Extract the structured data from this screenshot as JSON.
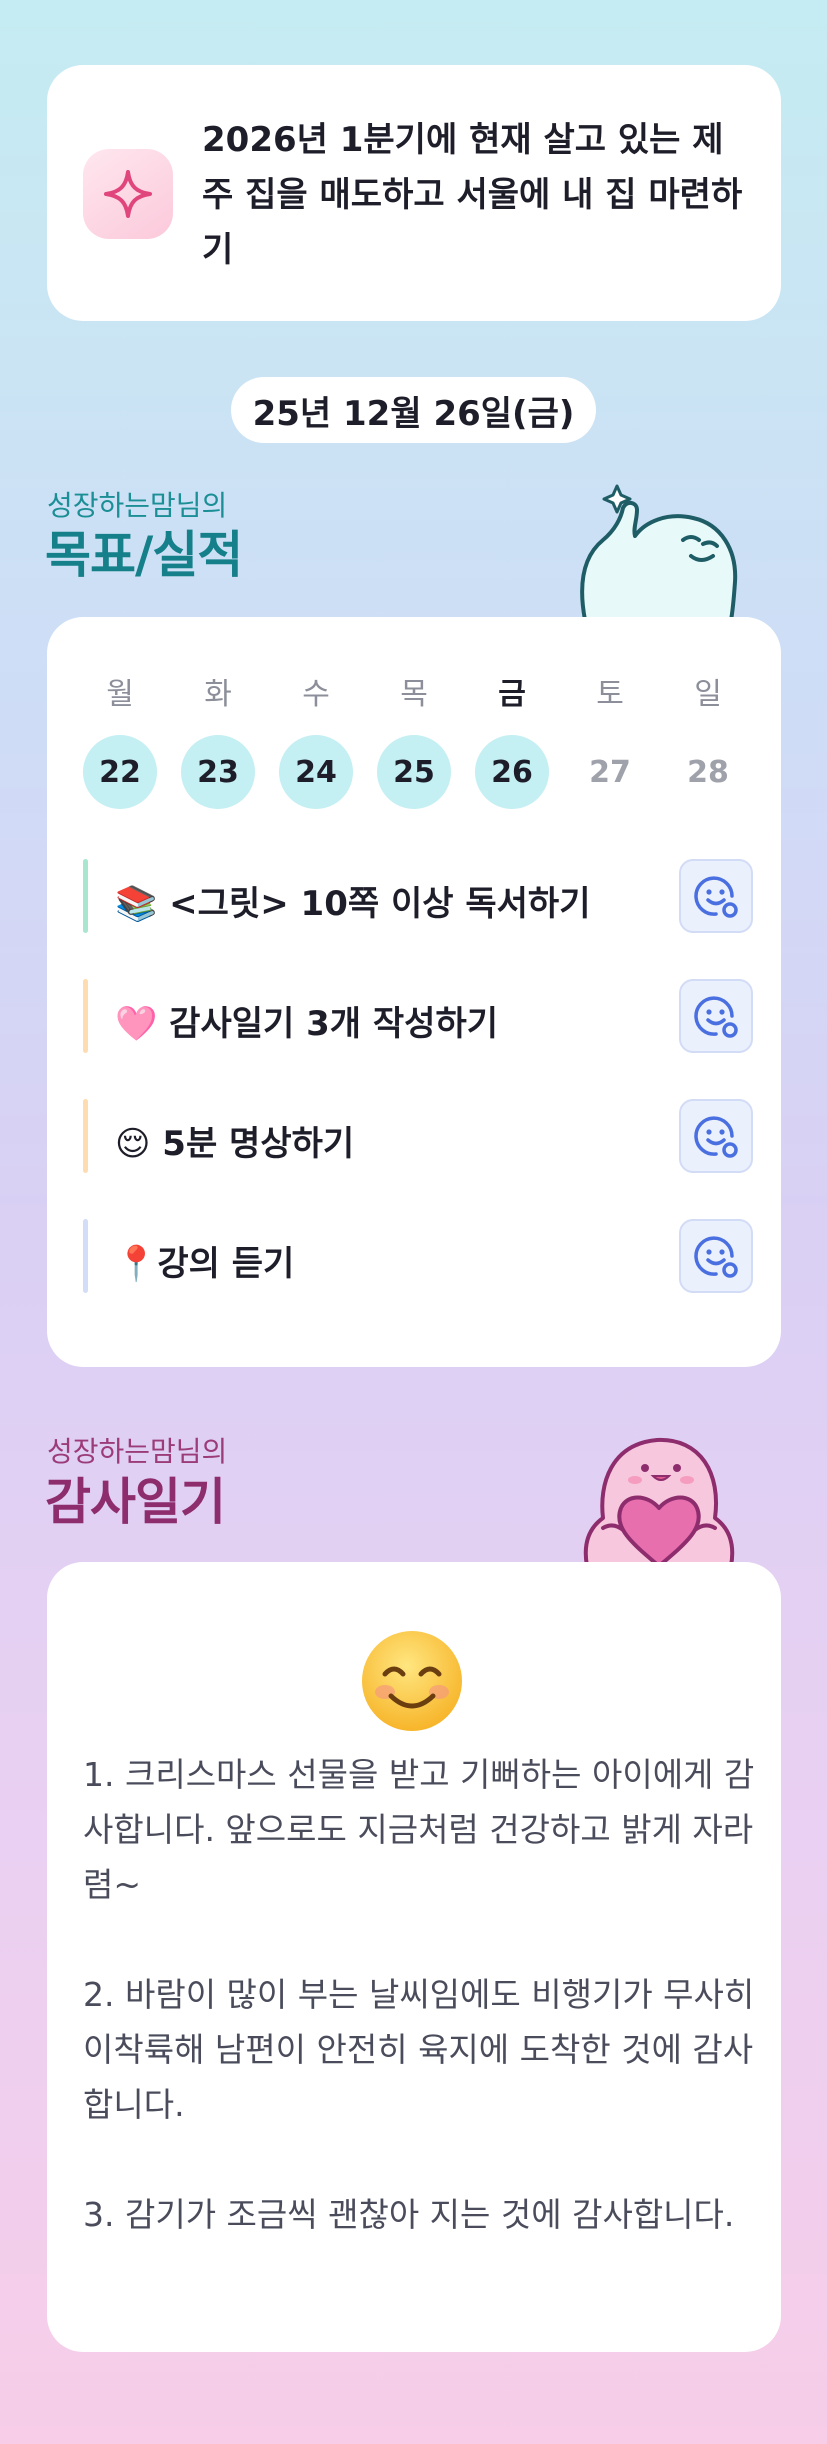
{
  "goal": {
    "icon": "sparkle-icon",
    "text": "2026년 1분기에 현재 살고 있는 제주 집을 매도하고 서울에 내 집 마련하기"
  },
  "date_label": "25년 12월 26일(금)",
  "goals_section": {
    "subtitle": "성장하는맘님의",
    "title": "목표/실적"
  },
  "week": {
    "days": [
      {
        "label": "월",
        "num": "22",
        "state": "done"
      },
      {
        "label": "화",
        "num": "23",
        "state": "done"
      },
      {
        "label": "수",
        "num": "24",
        "state": "done"
      },
      {
        "label": "목",
        "num": "25",
        "state": "done"
      },
      {
        "label": "금",
        "num": "26",
        "state": "today"
      },
      {
        "label": "토",
        "num": "27",
        "state": "future"
      },
      {
        "label": "일",
        "num": "28",
        "state": "future"
      }
    ]
  },
  "tasks": [
    {
      "text": "📚 <그릿> 10쪽 이상 독서하기",
      "bar_color": "#a8e6cf"
    },
    {
      "text": "🩷 감사일기 3개 작성하기",
      "bar_color": "#ffdcb0"
    },
    {
      "text": "😌 5분 명상하기",
      "bar_color": "#ffdcb0"
    },
    {
      "text": "📍강의 듣기",
      "bar_color": "#d4ddf7"
    }
  ],
  "diary_section": {
    "subtitle": "성장하는맘님의",
    "title": "감사일기"
  },
  "diary": {
    "emoji": "smiling-face-icon",
    "text": "1. 크리스마스 선물을 받고 기뻐하는 아이에게 감사합니다. 앞으로도 지금처럼 건강하고 밝게 자라렴~\n\n2. 바람이 많이 부는 날씨임에도 비행기가 무사히 이착륙해 남편이 안전히 육지에 도착한 것에 감사합니다.\n\n3. 감기가 조금씩 괜찮아 지는 것에 감사합니다."
  },
  "colors": {
    "accent_teal": "#15808a",
    "accent_plum": "#8e2d6e",
    "done_circle": "#c4eff3",
    "task_button": "#4a6fe0"
  }
}
